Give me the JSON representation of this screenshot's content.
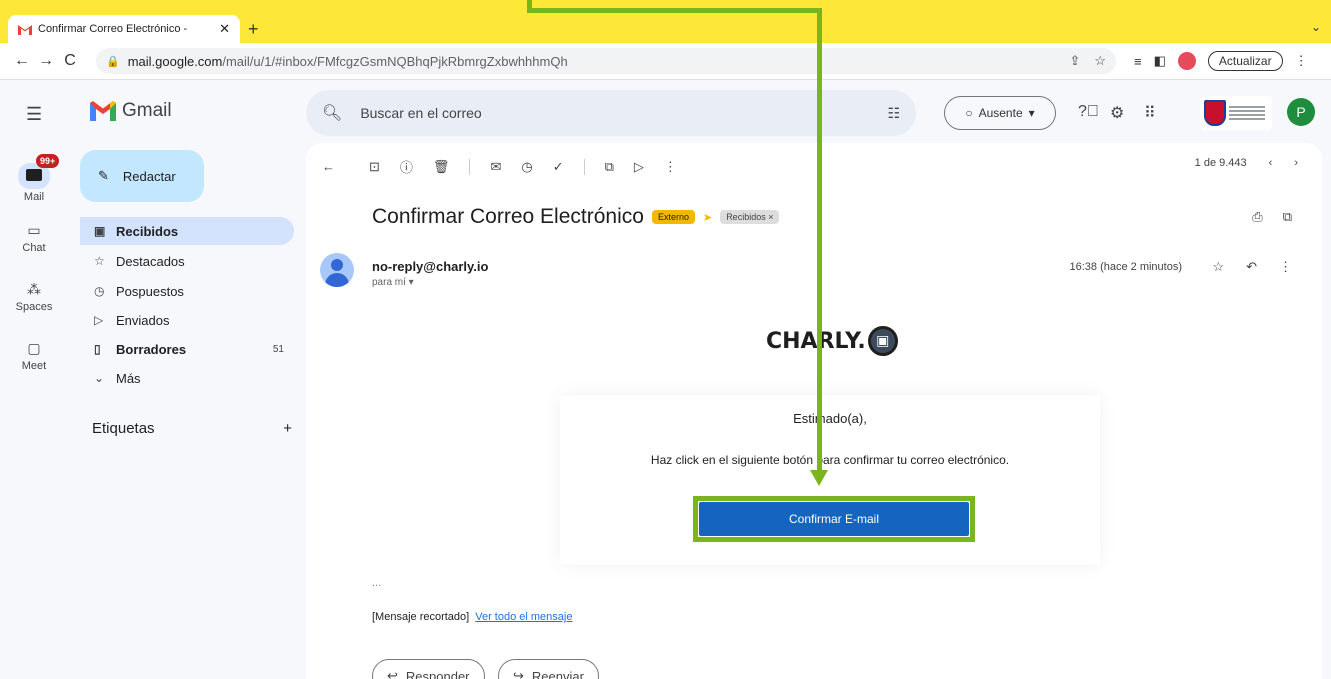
{
  "browser": {
    "tab_title": "Confirmar Correo Electrónico -",
    "tab_close": "✕",
    "new_tab": "+",
    "url_host": "mail.google.com",
    "url_path": "/mail/u/1/#inbox/FMfcgzGsmNQBhqPjkRbmrgZxbwhhhmQh",
    "update_label": "Actualizar"
  },
  "gmail": {
    "logo_text": "Gmail",
    "search_placeholder": "Buscar en el correo",
    "status_label": "Ausente",
    "avatar_letter": "P"
  },
  "rail": {
    "mail_label": "Mail",
    "badge": "99+",
    "chat_label": "Chat",
    "spaces_label": "Spaces",
    "meet_label": "Meet"
  },
  "compose_label": "Redactar",
  "nav": {
    "inbox": "Recibidos",
    "starred": "Destacados",
    "snoozed": "Pospuestos",
    "sent": "Enviados",
    "drafts": "Borradores",
    "drafts_count": "51",
    "more": "Más"
  },
  "labels_title": "Etiquetas",
  "pager_text": "1 de 9.443",
  "email": {
    "subject": "Confirmar Correo Electrónico",
    "chip_external": "Externo",
    "chip_inbox": "Recibidos ×",
    "sender": "no-reply@charly.io",
    "to": "para mí ▾",
    "time": "16:38 (hace 2 minutos)",
    "brand": "CHARLY.",
    "greeting": "Estimado(a),",
    "body": "Haz click en el siguiente botón para confirmar tu correo electrónico.",
    "button": "Confirmar E-mail",
    "ellipsis": "...",
    "trimmed": "[Mensaje recortado]",
    "view_all": "Ver todo el mensaje",
    "reply": "Responder",
    "forward": "Reenviar"
  },
  "colors": {
    "annotation_green": "#7ab51d",
    "tabbar_yellow": "#fde83a",
    "confirm_blue": "#1565c0"
  }
}
